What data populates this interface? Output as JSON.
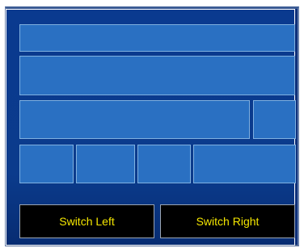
{
  "buttons": {
    "switch_left": "Switch Left",
    "switch_right": "Switch Right"
  },
  "colors": {
    "background": "#0a3a8f",
    "panel_fill": "#2a70c2",
    "panel_border": "#7fb0e0",
    "button_fill": "#000000",
    "button_text": "#f4e600"
  }
}
